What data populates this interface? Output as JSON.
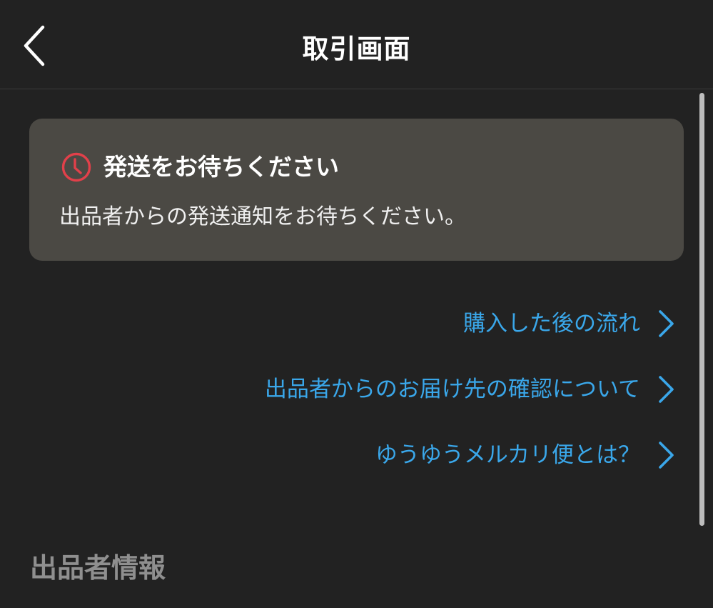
{
  "header": {
    "title": "取引画面",
    "back_icon": "chevron-left-icon"
  },
  "status_card": {
    "icon": "clock-icon",
    "title": "発送をお待ちください",
    "message": "出品者からの発送通知をお待ちください。"
  },
  "help_links": [
    {
      "label": "購入した後の流れ"
    },
    {
      "label": "出品者からのお届け先の確認について"
    },
    {
      "label": "ゆうゆうメルカリ便とは？"
    }
  ],
  "seller_section": {
    "title": "出品者情報"
  },
  "colors": {
    "background": "#222222",
    "card": "#4b4944",
    "link": "#3aa7ea",
    "clock": "#e2404a",
    "section_title": "#8f8f8f"
  }
}
